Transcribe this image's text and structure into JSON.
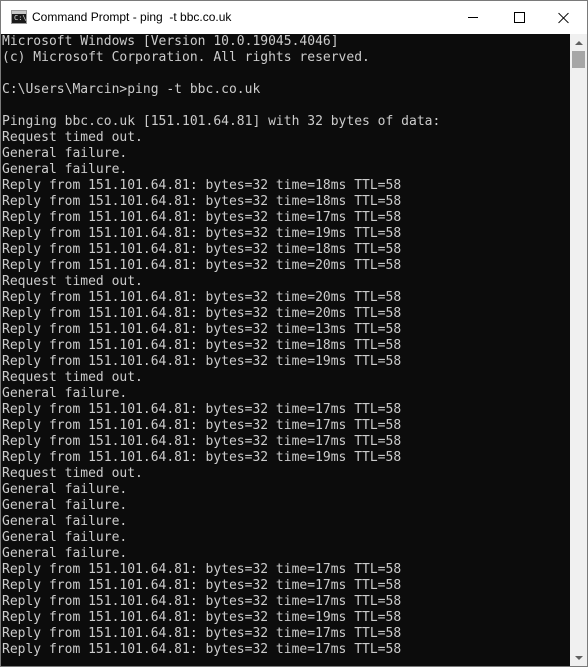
{
  "window": {
    "title": "Command Prompt - ping  -t bbc.co.uk",
    "icon": "cmd-icon",
    "icon_prompt": "C:\\",
    "controls": {
      "minimize_icon": "minimize-icon",
      "maximize_icon": "maximize-icon",
      "close_icon": "close-icon"
    }
  },
  "colors": {
    "console_background": "#0c0c0c",
    "console_text": "#cccccc",
    "titlebar_background": "#ffffff",
    "scrollbar_track": "#f0f0f0",
    "scrollbar_thumb": "#a6a6a6"
  },
  "console": {
    "lines": [
      "Microsoft Windows [Version 10.0.19045.4046]",
      "(c) Microsoft Corporation. All rights reserved.",
      "",
      "C:\\Users\\Marcin>ping -t bbc.co.uk",
      "",
      "Pinging bbc.co.uk [151.101.64.81] with 32 bytes of data:",
      "Request timed out.",
      "General failure.",
      "General failure.",
      "Reply from 151.101.64.81: bytes=32 time=18ms TTL=58",
      "Reply from 151.101.64.81: bytes=32 time=18ms TTL=58",
      "Reply from 151.101.64.81: bytes=32 time=17ms TTL=58",
      "Reply from 151.101.64.81: bytes=32 time=19ms TTL=58",
      "Reply from 151.101.64.81: bytes=32 time=18ms TTL=58",
      "Reply from 151.101.64.81: bytes=32 time=20ms TTL=58",
      "Request timed out.",
      "Reply from 151.101.64.81: bytes=32 time=20ms TTL=58",
      "Reply from 151.101.64.81: bytes=32 time=20ms TTL=58",
      "Reply from 151.101.64.81: bytes=32 time=13ms TTL=58",
      "Reply from 151.101.64.81: bytes=32 time=18ms TTL=58",
      "Reply from 151.101.64.81: bytes=32 time=19ms TTL=58",
      "Request timed out.",
      "General failure.",
      "Reply from 151.101.64.81: bytes=32 time=17ms TTL=58",
      "Reply from 151.101.64.81: bytes=32 time=17ms TTL=58",
      "Reply from 151.101.64.81: bytes=32 time=17ms TTL=58",
      "Reply from 151.101.64.81: bytes=32 time=19ms TTL=58",
      "Request timed out.",
      "General failure.",
      "General failure.",
      "General failure.",
      "General failure.",
      "General failure.",
      "Reply from 151.101.64.81: bytes=32 time=17ms TTL=58",
      "Reply from 151.101.64.81: bytes=32 time=17ms TTL=58",
      "Reply from 151.101.64.81: bytes=32 time=17ms TTL=58",
      "Reply from 151.101.64.81: bytes=32 time=19ms TTL=58",
      "Reply from 151.101.64.81: bytes=32 time=17ms TTL=58",
      "Reply from 151.101.64.81: bytes=32 time=17ms TTL=58"
    ]
  },
  "scrollbar": {
    "up_icon": "scroll-up-arrow-icon",
    "down_icon": "scroll-down-arrow-icon"
  }
}
